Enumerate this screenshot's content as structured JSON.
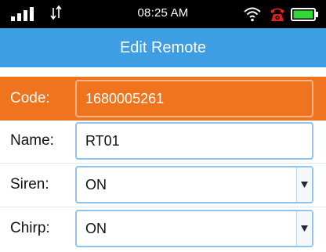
{
  "status_bar": {
    "time": "08:25 AM",
    "signal_icon": "signal-bars-icon",
    "data_icon": "data-transfer-icon",
    "wifi_icon": "wifi-icon",
    "alert_icon": "phone-alert-icon",
    "battery_icon": "battery-icon",
    "alert_color": "#e02020",
    "battery_fill_color": "#33d633"
  },
  "header": {
    "title": "Edit Remote",
    "background_color": "#3d9ee4"
  },
  "form": {
    "code": {
      "label": "Code:",
      "value": "1680005261",
      "background_color": "#f0741e"
    },
    "name": {
      "label": "Name:",
      "value": "RT01"
    },
    "siren": {
      "label": "Siren:",
      "selected": "ON",
      "arrow_icon": "dropdown-arrow-icon"
    },
    "chirp": {
      "label": "Chirp:",
      "selected": "ON",
      "arrow_icon": "dropdown-arrow-icon"
    }
  }
}
